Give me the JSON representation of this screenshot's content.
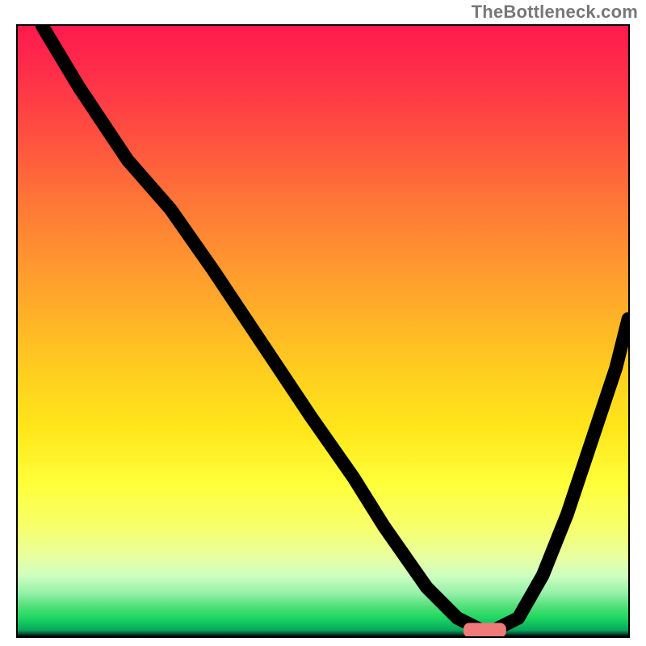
{
  "watermark": "TheBottleneck.com",
  "colors": {
    "gradient_top": "#ff1a4d",
    "gradient_mid": "#ffe61a",
    "gradient_bottom": "#07a85a",
    "curve": "#000000",
    "marker": "#ef7a7a",
    "frame": "#000000"
  },
  "chart_data": {
    "type": "line",
    "title": "",
    "xlabel": "",
    "ylabel": "",
    "xlim": [
      0,
      100
    ],
    "ylim": [
      0,
      100
    ],
    "series": [
      {
        "name": "curve",
        "x": [
          4,
          10,
          18,
          25,
          32,
          40,
          48,
          55,
          60,
          67,
          72,
          76,
          78,
          82,
          86,
          90,
          94,
          98,
          100
        ],
        "y": [
          100,
          90,
          78,
          70,
          60,
          48,
          36,
          26,
          18,
          8,
          3,
          1,
          1,
          3,
          10,
          20,
          32,
          44,
          52
        ]
      }
    ],
    "marker": {
      "name": "optimal-range",
      "x_start": 73,
      "x_end": 80,
      "y": 1
    },
    "background": "vertical-rainbow-gradient"
  }
}
